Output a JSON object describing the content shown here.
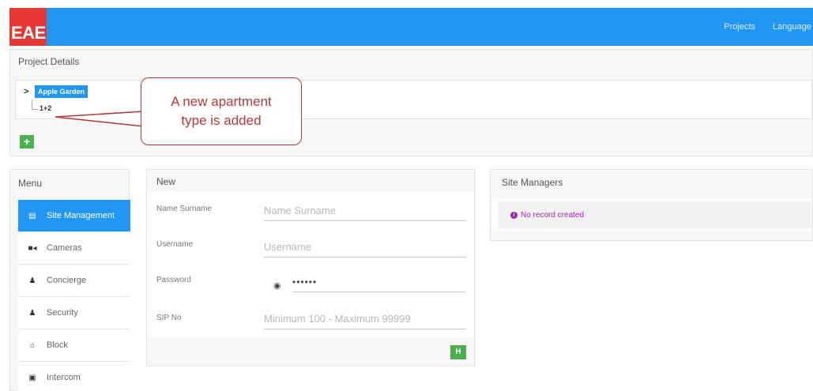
{
  "header": {
    "logo_text": "EAE",
    "nav": [
      "Projects",
      "Language"
    ],
    "brand_color": "#2196f3",
    "logo_color": "#e53935"
  },
  "project_details": {
    "title": "Project Details",
    "tree": {
      "root": "Apple Garden",
      "child": "1+2"
    },
    "add_button": "+"
  },
  "callout": {
    "text": "A new apartment type is added"
  },
  "menu": {
    "title": "Menu",
    "items": [
      {
        "label": "Site Management",
        "icon": "list-icon",
        "glyph": "▤",
        "active": true
      },
      {
        "label": "Cameras",
        "icon": "camera-icon",
        "glyph": "■◂",
        "active": false
      },
      {
        "label": "Concierge",
        "icon": "user-icon",
        "glyph": "♟",
        "active": false
      },
      {
        "label": "Security",
        "icon": "user-icon",
        "glyph": "♟",
        "active": false
      },
      {
        "label": "Block",
        "icon": "home-icon",
        "glyph": "⌂",
        "active": false
      },
      {
        "label": "Intercom",
        "icon": "intercom-icon",
        "glyph": "▣",
        "active": false
      }
    ]
  },
  "new_form": {
    "title": "New",
    "fields": {
      "name": {
        "label": "Name Surname",
        "placeholder": "Name Surname"
      },
      "username": {
        "label": "Username",
        "placeholder": "Username"
      },
      "password": {
        "label": "Password",
        "value": "••••••"
      },
      "sip": {
        "label": "SIP No",
        "placeholder": "Minimum 100 - Maximum 99999"
      }
    },
    "save_glyph": "H"
  },
  "site_managers": {
    "title": "Site Managers",
    "empty_message": "No record created"
  }
}
